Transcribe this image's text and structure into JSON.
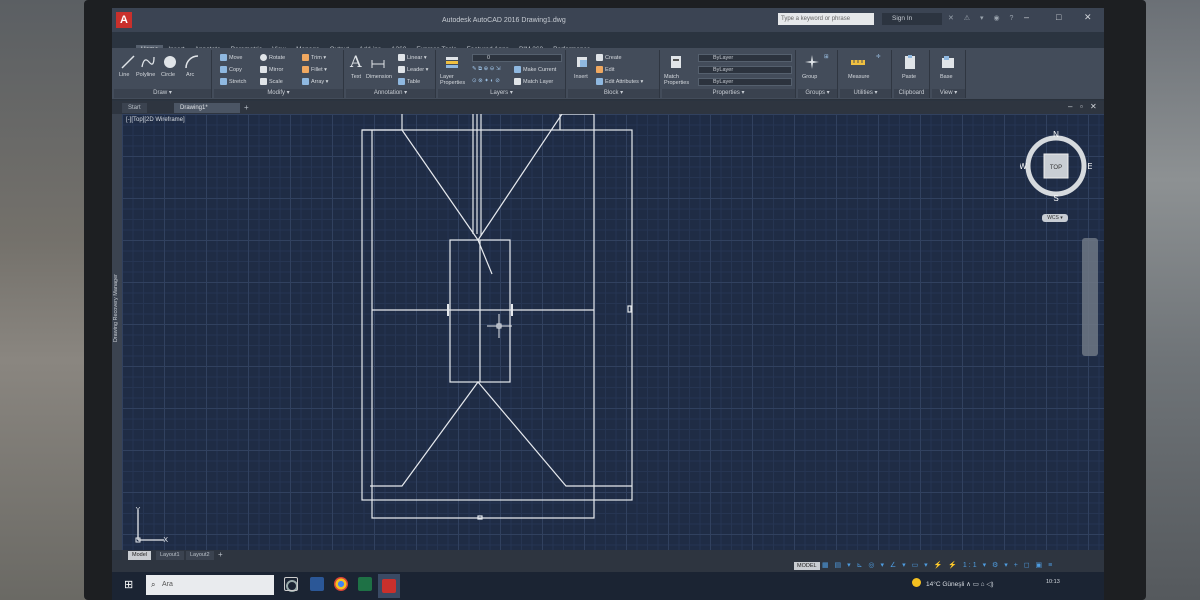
{
  "titlebar": {
    "doc_title": "Autodesk AutoCAD 2016   Drawing1.dwg",
    "search_placeholder": "Type a keyword or phrase",
    "signin": "Sign In",
    "win_min": "–",
    "win_max": "□",
    "win_close": "✕"
  },
  "tabs": [
    "Home",
    "Insert",
    "Annotate",
    "Parametric",
    "View",
    "Manage",
    "Output",
    "Add-ins",
    "A360",
    "Express Tools",
    "Featured Apps",
    "BIM 360",
    "Performance"
  ],
  "ribbon": {
    "draw": {
      "title": "Draw ▾",
      "line": "Line",
      "polyline": "Polyline",
      "circle": "Circle",
      "arc": "Arc"
    },
    "modify": {
      "title": "Modify ▾",
      "move": "Move",
      "rotate": "Rotate",
      "trim": "Trim ▾",
      "copy": "Copy",
      "mirror": "Mirror",
      "fillet": "Fillet ▾",
      "stretch": "Stretch",
      "scale": "Scale",
      "array": "Array ▾"
    },
    "annotation": {
      "title": "Annotation ▾",
      "text": "Text",
      "dimension": "Dimension",
      "linear": "Linear ▾",
      "leader": "Leader ▾",
      "table": "Table"
    },
    "layers": {
      "title": "Layers ▾",
      "layer_properties": "Layer Properties",
      "layer_value": "0",
      "make_current": "Make Current",
      "match_layer": "Match Layer"
    },
    "block": {
      "title": "Block ▾",
      "insert": "Insert",
      "create": "Create",
      "edit": "Edit",
      "edit_attributes": "Edit Attributes ▾"
    },
    "properties": {
      "title": "Properties ▾",
      "match_properties": "Match Properties",
      "bylayer1": "ByLayer",
      "bylayer2": "ByLayer",
      "bylayer3": "ByLayer"
    },
    "groups": {
      "title": "Groups ▾",
      "group": "Group"
    },
    "utilities": {
      "title": "Utilities ▾",
      "measure": "Measure"
    },
    "clipboard": {
      "title": "Clipboard",
      "paste": "Paste"
    },
    "view": {
      "title": "View ▾",
      "base": "Base"
    }
  },
  "file_tabs": {
    "start": "Start",
    "drawing": "Drawing1*",
    "plus": "+"
  },
  "viewport": {
    "label": "[-][Top][2D Wireframe]",
    "palette_label": "Drawing Recovery Manager",
    "compass": {
      "n": "N",
      "s": "S",
      "e": "E",
      "w": "W",
      "top": "TOP"
    },
    "wcs": "WCS ▾",
    "ucs_x": "X",
    "ucs_y": "Y"
  },
  "layout_tabs": {
    "model": "Model",
    "layout1": "Layout1",
    "layout2": "Layout2",
    "plus": "+"
  },
  "statusbar": {
    "model": "MODEL",
    "icons": "▦ ▤ ▾ ⊾ ◎ ▾ ∠ ▾ ▭ ▾ ⚡ ⚡ 1:1 ▾ ⚙ ▾ + ◻ ▣ ≡"
  },
  "taskbar": {
    "search_placeholder": "Ara",
    "weather": "14°C  Güneşli  ∧  ▭  ⌂  ◁)",
    "clock": "10:13"
  },
  "colors": {
    "drawing_line": "#e6e9ee",
    "canvas_bg": "#1f2c45",
    "accent": "#c9302c"
  }
}
